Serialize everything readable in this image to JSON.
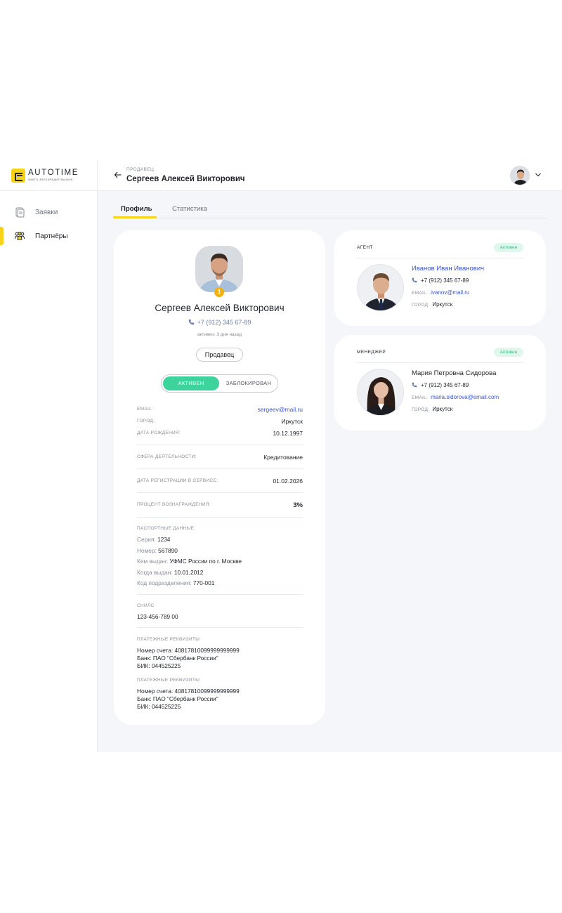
{
  "brand": {
    "title": "AUTOTIME",
    "subtitle": "ФАКТО АВТОКРЕДИТОВАНИЯ"
  },
  "sidebar": {
    "items": [
      {
        "label": "Заявки",
        "icon": "document-icon",
        "active": false
      },
      {
        "label": "Партнёры",
        "icon": "people-icon",
        "active": true
      }
    ]
  },
  "header": {
    "role_label": "ПРОДАВЕЦ",
    "title": "Сергеев Алексей Викторович"
  },
  "tabs": [
    {
      "label": "Профиль",
      "active": true
    },
    {
      "label": "Статистика",
      "active": false
    }
  ],
  "profile": {
    "name": "Сергеев Алексей Викторович",
    "phone": "+7 (912) 345 67-89",
    "last_active": "активен: 3 дня назад",
    "rank_badge": "1",
    "role": "Продавец",
    "status": {
      "active_label": "АКТИВЕН",
      "blocked_label": "ЗАБЛОКИРОВАН",
      "current": "active"
    },
    "fields": {
      "email": {
        "label": "EMAIL:",
        "value": "sergeev@mail.ru"
      },
      "city": {
        "label": "ГОРОД:",
        "value": "Иркутск"
      },
      "birth_date": {
        "label": "ДАТА РОЖДЕНИЯ:",
        "value": "10.12.1997"
      },
      "activity": {
        "label": "СФЕРА ДЕЯТЕЛЬНОСТИ:",
        "value": "Кредитование"
      },
      "reg_date": {
        "label": "ДАТА РЕГИСТРАЦИИ В СЕРВИСЕ:",
        "value": "01.02.2026"
      },
      "commission": {
        "label": "ПРОЦЕНТ  ВОЗНАГРАЖДЕНИЯ:",
        "value": "3%"
      }
    },
    "passport": {
      "title": "ПАСПОРТНЫЕ ДАННЫЕ",
      "series_label": "Серия:",
      "series": "1234",
      "number_label": "Номер:",
      "number": "567890",
      "issued_by_label": "Кем выдан:",
      "issued_by": "УФМС России по г. Москве",
      "issued_date_label": "Когда выдан:",
      "issued_date": "10.01.2012",
      "dept_code_label": "Код подразделения:",
      "dept_code": "770-001"
    },
    "snils": {
      "title": "СНИЛС",
      "value": "123-456-789 00"
    },
    "payments": [
      {
        "title": "ПЛАТЕЖНЫЕ РЕКВИЗИТЫ",
        "account": "Номер счета: 40817810099999999999",
        "bank": "Банк: ПАО \"Сбербанк России\"",
        "bik": "БИК: 044525225"
      },
      {
        "title": "ПЛАТЕЖНЫЕ РЕКВИЗИТЫ",
        "account": "Номер счета: 40817810099999999999",
        "bank": "Банк: ПАО \"Сбербанк России\"",
        "bik": "БИК: 044525225"
      }
    ]
  },
  "agent": {
    "title": "АГЕНТ",
    "badge": "Активен",
    "name": "Иванов Иван Иванович",
    "phone": "+7 (912) 345 67-89",
    "email_label": "EMAIL:",
    "email": "ivanov@mail.ru",
    "city_label": "ГОРОД:",
    "city": "Иркутск"
  },
  "manager": {
    "title": "МЕНЕДЖЕР",
    "badge": "Активен",
    "name": "Мария Петровна Сидорова",
    "phone": "+7 (912) 345 67-89",
    "email_label": "EMAIL:",
    "email": "maria.sidorova@email.com",
    "city_label": "ГОРОД:",
    "city": "Иркутск"
  },
  "colors": {
    "accent": "#f7d417",
    "success": "#3dd39c",
    "link": "#3b55c8",
    "background": "#f4f6f9"
  }
}
